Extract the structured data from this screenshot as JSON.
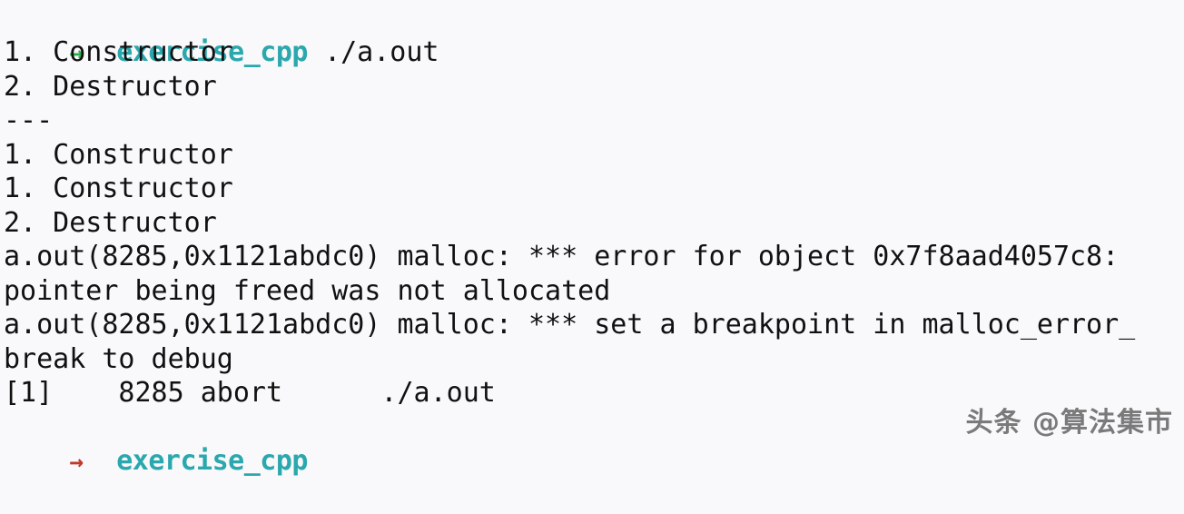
{
  "terminal": {
    "background_color": "#f9f8fb",
    "foreground_color": "#111111",
    "prompt_ok_color": "#27b34a",
    "prompt_fail_color": "#c0392b",
    "cwd_color": "#2aa8ae",
    "prompt_top": {
      "arrow": "→",
      "arrow_state": "ok",
      "cwd": "exercise_cpp",
      "command": "./a.out"
    },
    "output_lines": [
      "1. Constructor",
      "2. Destructor",
      "---",
      "1. Constructor",
      "1. Constructor",
      "2. Destructor",
      "a.out(8285,0x1121abdc0) malloc: *** error for object 0x7f8aad4057c8:",
      "pointer being freed was not allocated",
      "a.out(8285,0x1121abdc0) malloc: *** set a breakpoint in malloc_error_",
      "break to debug",
      "[1]    8285 abort      ./a.out"
    ],
    "prompt_bottom": {
      "arrow": "→",
      "arrow_state": "fail",
      "cwd": "exercise_cpp",
      "command": ""
    }
  },
  "watermark": {
    "text": "头条 @算法集市"
  }
}
